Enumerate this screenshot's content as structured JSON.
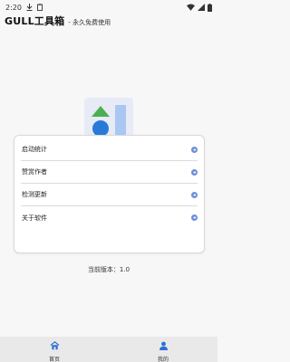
{
  "status_bar": {
    "time": "2:20",
    "icons": [
      "download-icon",
      "clipboard-icon",
      "wifi-icon",
      "signal-icon",
      "battery-icon"
    ]
  },
  "header": {
    "title": "GULL工具箱",
    "subtitle": "- 永久免费使用"
  },
  "logo": {
    "icon": "app-logo-icon",
    "colors": {
      "background": "#e6ebf6",
      "triangle": "#4caf50",
      "circle": "#2979d9",
      "bar": "#a9c7f2"
    }
  },
  "menu": {
    "items": [
      {
        "label": "启动统计"
      },
      {
        "label": "赞赏作者"
      },
      {
        "label": "检测更新"
      },
      {
        "label": "关于软件"
      }
    ],
    "arrow_icon": "chevron-right-icon",
    "accent": "#6d8fd8"
  },
  "version": {
    "text": "当前版本：1.0"
  },
  "bottom_nav": {
    "items": [
      {
        "label": "首页",
        "icon": "home-icon"
      },
      {
        "label": "我的",
        "icon": "user-icon"
      }
    ],
    "accent": "#2c6fd6"
  }
}
